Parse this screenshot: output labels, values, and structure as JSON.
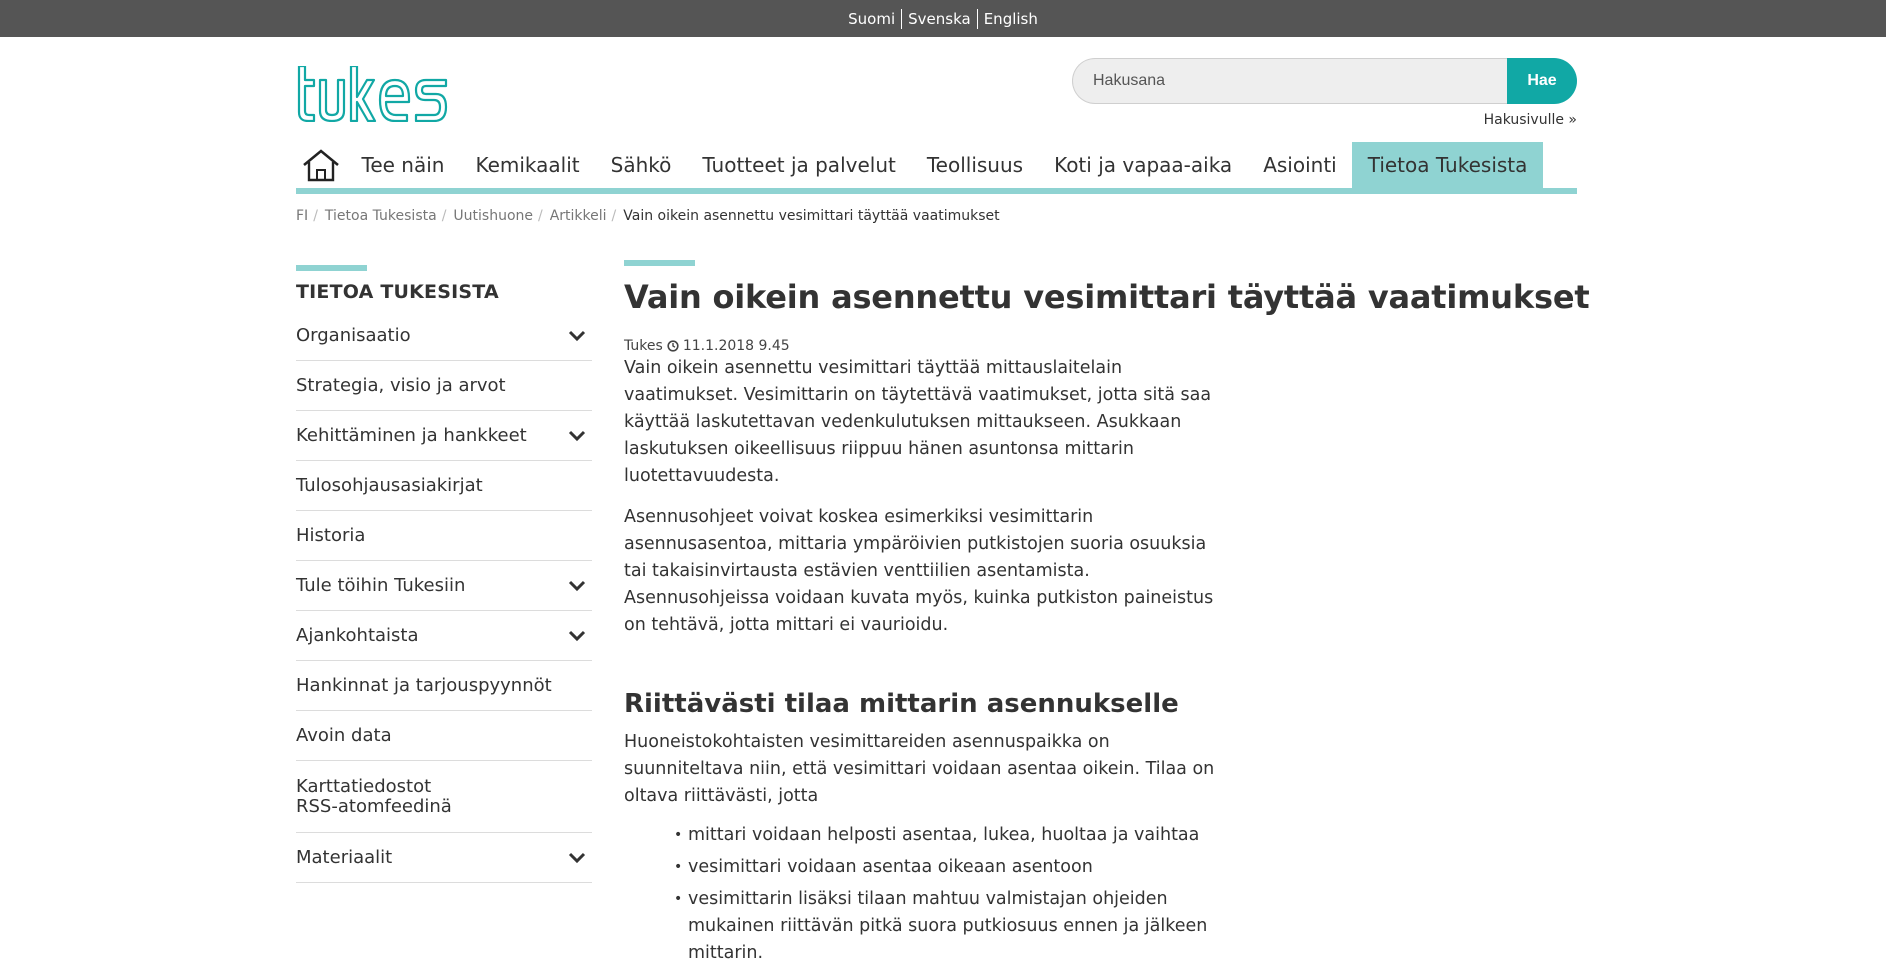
{
  "languages": [
    "Suomi",
    "Svenska",
    "English"
  ],
  "logo": {
    "text": "tukes",
    "color": "#11a8a5"
  },
  "search": {
    "placeholder": "Hakusana",
    "button_label": "Hae",
    "link_label": "Hakusivulle »"
  },
  "nav": {
    "home_icon": "home-icon",
    "items": [
      {
        "label": "Tee näin"
      },
      {
        "label": "Kemikaalit"
      },
      {
        "label": "Sähkö"
      },
      {
        "label": "Tuotteet ja palvelut"
      },
      {
        "label": "Teollisuus"
      },
      {
        "label": "Koti ja vapaa-aika"
      },
      {
        "label": "Asiointi"
      },
      {
        "label": "Tietoa Tukesista",
        "active": true
      }
    ],
    "accent_color": "#8fd3d2"
  },
  "breadcrumb": {
    "items": [
      "FI",
      "Tietoa Tukesista",
      "Uutishuone",
      "Artikkeli"
    ],
    "current": "Vain oikein asennettu vesimittari täyttää vaatimukset"
  },
  "sidebar": {
    "title": "TIETOA TUKESISTA",
    "items": [
      {
        "label": "Organisaatio",
        "expandable": true
      },
      {
        "label": "Strategia, visio ja arvot",
        "expandable": false
      },
      {
        "label": "Kehittäminen ja hankkeet",
        "expandable": true
      },
      {
        "label": "Tulosohjausasiakirjat",
        "expandable": false
      },
      {
        "label": "Historia",
        "expandable": false
      },
      {
        "label": "Tule töihin Tukesiin",
        "expandable": true
      },
      {
        "label": "Ajankohtaista",
        "expandable": true
      },
      {
        "label": "Hankinnat ja tarjouspyynnöt",
        "expandable": false
      },
      {
        "label": "Avoin data",
        "expandable": false
      },
      {
        "label": "Karttatiedostot RSS-atomfeedinä",
        "expandable": false
      },
      {
        "label": "Materiaalit",
        "expandable": true
      }
    ]
  },
  "article": {
    "title": "Vain oikein asennettu vesimittari täyttää vaatimukset",
    "author": "Tukes",
    "date": "11.1.2018 9.45",
    "paragraphs": [
      "Vain oikein asennettu vesimittari täyttää mittauslaitelain vaatimukset. Vesimittarin on täytettävä vaatimukset, jotta sitä saa käyttää laskutettavan vedenkulutuksen mittaukseen. Asukkaan laskutuksen oikeellisuus riippuu hänen asuntonsa mittarin luotettavuudesta.",
      "Asennusohjeet voivat koskea esimerkiksi vesimittarin asennusasentoa, mittaria ympäröivien putkistojen suoria osuuksia tai takaisinvirtausta estävien venttiilien asentamista. Asennusohjeissa voidaan kuvata myös, kuinka putkiston paineistus on tehtävä, jotta mittari ei vaurioidu."
    ],
    "subheading": "Riittävästi tilaa mittarin asennukselle",
    "subparagraph": "Huoneistokohtaisten vesimittareiden asennuspaikka on suunniteltava niin, että vesimittari voidaan asentaa oikein. Tilaa on oltava riittävästi, jotta",
    "bullets": [
      "mittari voidaan helposti asentaa, lukea, huoltaa ja vaihtaa",
      "vesimittari voidaan asentaa oikeaan asentoon",
      "vesimittarin lisäksi tilaan mahtuu valmistajan ohjeiden mukainen riittävän pitkä suora putkiosuus ennen ja jälkeen mittarin."
    ]
  }
}
